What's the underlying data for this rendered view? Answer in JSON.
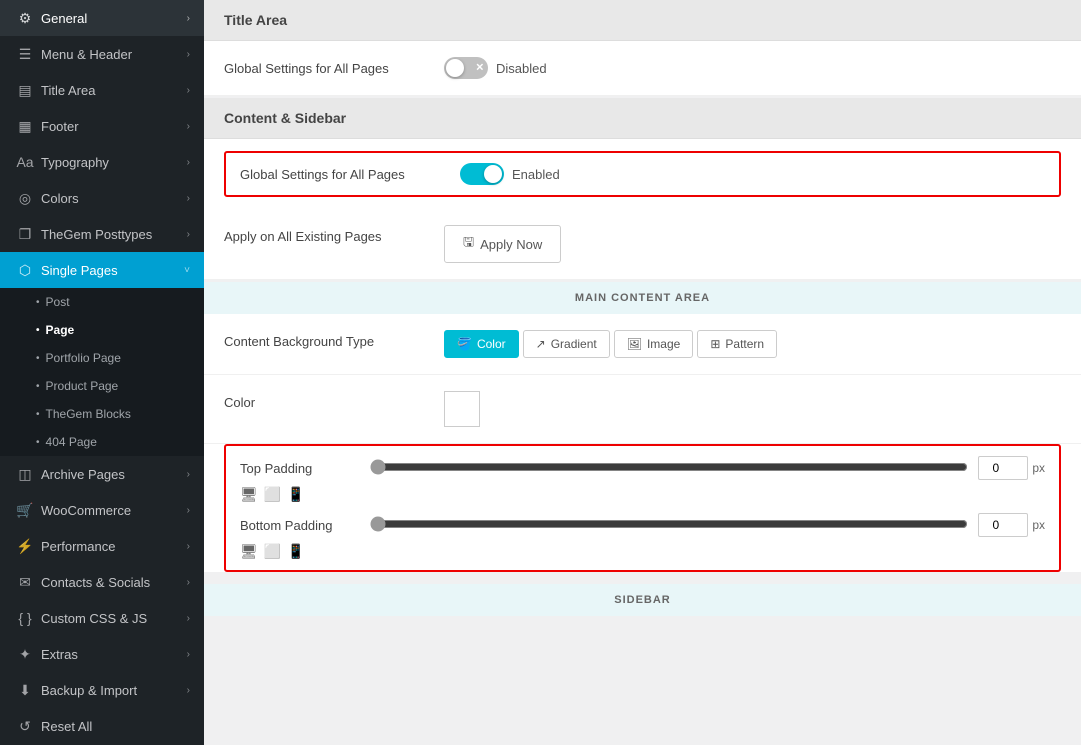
{
  "sidebar": {
    "items": [
      {
        "id": "general",
        "label": "General",
        "icon": "⚙",
        "hasChevron": true,
        "active": false
      },
      {
        "id": "menu-header",
        "label": "Menu & Header",
        "icon": "☰",
        "hasChevron": true,
        "active": false
      },
      {
        "id": "title-area",
        "label": "Title Area",
        "icon": "▤",
        "hasChevron": true,
        "active": false
      },
      {
        "id": "footer",
        "label": "Footer",
        "icon": "▦",
        "hasChevron": true,
        "active": false
      },
      {
        "id": "typography",
        "label": "Typography",
        "icon": "Aa",
        "hasChevron": true,
        "active": false
      },
      {
        "id": "colors",
        "label": "Colors",
        "icon": "◎",
        "hasChevron": true,
        "active": false
      },
      {
        "id": "thegem-posttypes",
        "label": "TheGem Posttypes",
        "icon": "❐",
        "hasChevron": true,
        "active": false
      },
      {
        "id": "single-pages",
        "label": "Single Pages",
        "icon": "⬡",
        "hasChevron": true,
        "active": true
      }
    ],
    "subItems": [
      {
        "id": "post",
        "label": "Post",
        "active": false
      },
      {
        "id": "page",
        "label": "Page",
        "active": true
      },
      {
        "id": "portfolio-page",
        "label": "Portfolio Page",
        "active": false
      },
      {
        "id": "product-page",
        "label": "Product Page",
        "active": false
      },
      {
        "id": "thegem-blocks",
        "label": "TheGem Blocks",
        "active": false
      },
      {
        "id": "404-page",
        "label": "404 Page",
        "active": false
      }
    ],
    "bottomItems": [
      {
        "id": "archive-pages",
        "label": "Archive Pages",
        "icon": "◫",
        "hasChevron": true
      },
      {
        "id": "woocommerce",
        "label": "WooCommerce",
        "icon": "🛒",
        "hasChevron": true
      },
      {
        "id": "performance",
        "label": "Performance",
        "icon": "⚡",
        "hasChevron": true
      },
      {
        "id": "contacts-socials",
        "label": "Contacts & Socials",
        "icon": "📞",
        "hasChevron": true
      },
      {
        "id": "custom-css-js",
        "label": "Custom CSS & JS",
        "icon": "{ }",
        "hasChevron": true
      },
      {
        "id": "extras",
        "label": "Extras",
        "icon": "✦",
        "hasChevron": true
      },
      {
        "id": "backup-import",
        "label": "Backup & Import",
        "icon": "⬇",
        "hasChevron": true
      },
      {
        "id": "reset-all",
        "label": "Reset All",
        "icon": "↺",
        "hasChevron": false
      }
    ]
  },
  "titleArea": {
    "sectionLabel": "Title Area",
    "globalSettingsLabel": "Global Settings for All Pages",
    "globalSettingsStatus": "Disabled",
    "toggleState": "off"
  },
  "contentSidebar": {
    "sectionLabel": "Content & Sidebar",
    "globalSettingsLabel": "Global Settings for All Pages",
    "globalSettingsStatus": "Enabled",
    "toggleState": "on",
    "applyOnAllLabel": "Apply on All Existing Pages",
    "applyNowLabel": "Apply Now"
  },
  "mainContentArea": {
    "bannerLabel": "MAIN CONTENT AREA",
    "contentBgTypeLabel": "Content Background Type",
    "bgTypeOptions": [
      {
        "id": "color",
        "label": "Color",
        "active": true
      },
      {
        "id": "gradient",
        "label": "Gradient",
        "active": false
      },
      {
        "id": "image",
        "label": "Image",
        "active": false
      },
      {
        "id": "pattern",
        "label": "Pattern",
        "active": false
      }
    ],
    "colorLabel": "Color",
    "topPaddingLabel": "Top Padding",
    "topPaddingValue": "0",
    "topPaddingUnit": "px",
    "bottomPaddingLabel": "Bottom Padding",
    "bottomPaddingValue": "0",
    "bottomPaddingUnit": "px"
  },
  "sidebar2": {
    "bannerLabel": "SIDEBAR"
  }
}
